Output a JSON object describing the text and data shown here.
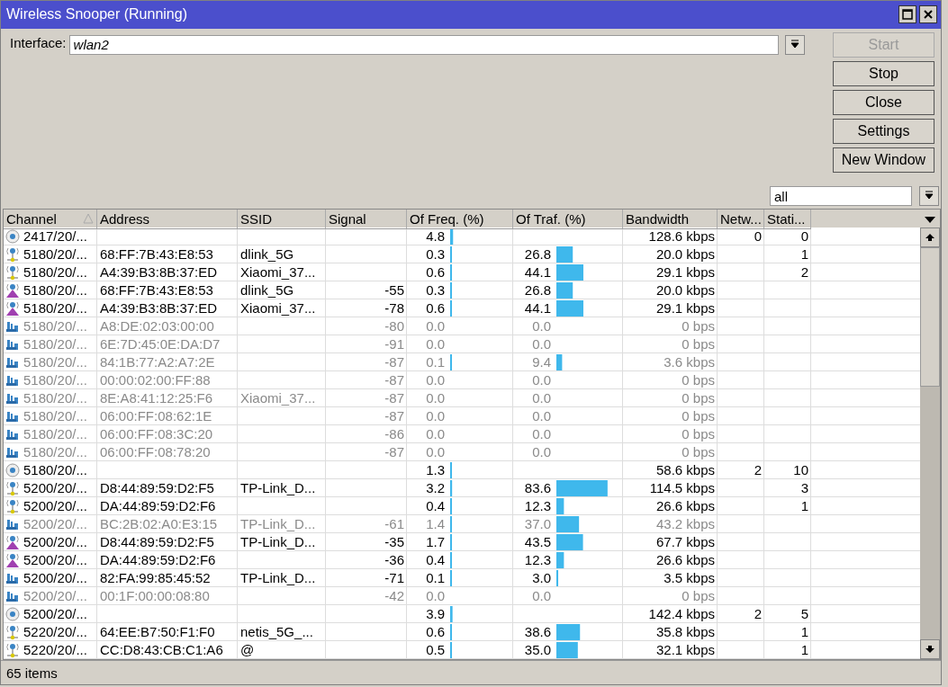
{
  "window": {
    "title": "Wireless Snooper (Running)"
  },
  "interface": {
    "label": "Interface:",
    "value": "wlan2"
  },
  "buttons": [
    {
      "label": "Start",
      "disabled": true
    },
    {
      "label": "Stop",
      "disabled": false
    },
    {
      "label": "Close",
      "disabled": false
    },
    {
      "label": "Settings",
      "disabled": false
    },
    {
      "label": "New Window",
      "disabled": false
    }
  ],
  "filter": {
    "value": "all"
  },
  "columns": [
    {
      "label": "Channel",
      "sorted": true
    },
    {
      "label": "Address",
      "sorted": false
    },
    {
      "label": "SSID",
      "sorted": false
    },
    {
      "label": "Signal",
      "sorted": false
    },
    {
      "label": "Of Freq. (%)",
      "sorted": false
    },
    {
      "label": "Of Traf. (%)",
      "sorted": false
    },
    {
      "label": "Bandwidth",
      "sorted": false
    },
    {
      "label": "Netw...",
      "sorted": false
    },
    {
      "label": "Stati...",
      "sorted": false
    }
  ],
  "rows": [
    {
      "kind": "network",
      "dimmed": false,
      "channel": "2417/20/...",
      "freq": {
        "text": "4.8",
        "level": 0.048
      },
      "bandwidth": "128.6 kbps",
      "networks": "0",
      "stations": "0"
    },
    {
      "kind": "ap",
      "dimmed": false,
      "channel": "5180/20/...",
      "address": "68:FF:7B:43:E8:53",
      "ssid": "dlink_5G",
      "freq": {
        "text": "0.3",
        "level": 0.003
      },
      "traf": {
        "text": "26.8",
        "level": 0.268
      },
      "bandwidth": "20.0 kbps",
      "stations": "1"
    },
    {
      "kind": "ap",
      "dimmed": false,
      "channel": "5180/20/...",
      "address": "A4:39:B3:8B:37:ED",
      "ssid": "Xiaomi_37...",
      "freq": {
        "text": "0.6",
        "level": 0.006
      },
      "traf": {
        "text": "44.1",
        "level": 0.441
      },
      "bandwidth": "29.1 kbps",
      "stations": "2"
    },
    {
      "kind": "station",
      "dimmed": false,
      "channel": "5180/20/...",
      "address": "68:FF:7B:43:E8:53",
      "ssid": "dlink_5G",
      "signal": "-55",
      "freq": {
        "text": "0.3",
        "level": 0.003
      },
      "traf": {
        "text": "26.8",
        "level": 0.268
      },
      "bandwidth": "20.0 kbps"
    },
    {
      "kind": "station",
      "dimmed": false,
      "channel": "5180/20/...",
      "address": "A4:39:B3:8B:37:ED",
      "ssid": "Xiaomi_37...",
      "signal": "-78",
      "freq": {
        "text": "0.6",
        "level": 0.006
      },
      "traf": {
        "text": "44.1",
        "level": 0.441
      },
      "bandwidth": "29.1 kbps"
    },
    {
      "kind": "device",
      "dimmed": true,
      "channel": "5180/20/...",
      "address": "A8:DE:02:03:00:00",
      "signal": "-80",
      "freq": {
        "text": "0.0"
      },
      "traf": {
        "text": "0.0"
      },
      "bandwidth": "0 bps"
    },
    {
      "kind": "device",
      "dimmed": true,
      "channel": "5180/20/...",
      "address": "6E:7D:45:0E:DA:D7",
      "signal": "-91",
      "freq": {
        "text": "0.0"
      },
      "traf": {
        "text": "0.0"
      },
      "bandwidth": "0 bps"
    },
    {
      "kind": "device",
      "dimmed": true,
      "channel": "5180/20/...",
      "address": "84:1B:77:A2:A7:2E",
      "signal": "-87",
      "freq": {
        "text": "0.1",
        "level": 0.001
      },
      "traf": {
        "text": "9.4",
        "level": 0.094
      },
      "bandwidth": "3.6 kbps"
    },
    {
      "kind": "device",
      "dimmed": true,
      "channel": "5180/20/...",
      "address": "00:00:02:00:FF:88",
      "signal": "-87",
      "freq": {
        "text": "0.0"
      },
      "traf": {
        "text": "0.0"
      },
      "bandwidth": "0 bps"
    },
    {
      "kind": "device",
      "dimmed": true,
      "channel": "5180/20/...",
      "address": "8E:A8:41:12:25:F6",
      "ssid": "Xiaomi_37...",
      "signal": "-87",
      "freq": {
        "text": "0.0"
      },
      "traf": {
        "text": "0.0"
      },
      "bandwidth": "0 bps"
    },
    {
      "kind": "device",
      "dimmed": true,
      "channel": "5180/20/...",
      "address": "06:00:FF:08:62:1E",
      "signal": "-87",
      "freq": {
        "text": "0.0"
      },
      "traf": {
        "text": "0.0"
      },
      "bandwidth": "0 bps"
    },
    {
      "kind": "device",
      "dimmed": true,
      "channel": "5180/20/...",
      "address": "06:00:FF:08:3C:20",
      "signal": "-86",
      "freq": {
        "text": "0.0"
      },
      "traf": {
        "text": "0.0"
      },
      "bandwidth": "0 bps"
    },
    {
      "kind": "device",
      "dimmed": true,
      "channel": "5180/20/...",
      "address": "06:00:FF:08:78:20",
      "signal": "-87",
      "freq": {
        "text": "0.0"
      },
      "traf": {
        "text": "0.0"
      },
      "bandwidth": "0 bps"
    },
    {
      "kind": "network",
      "dimmed": false,
      "channel": "5180/20/...",
      "freq": {
        "text": "1.3",
        "level": 0.013
      },
      "bandwidth": "58.6 kbps",
      "networks": "2",
      "stations": "10"
    },
    {
      "kind": "ap",
      "dimmed": false,
      "channel": "5200/20/...",
      "address": "D8:44:89:59:D2:F5",
      "ssid": "TP-Link_D...",
      "freq": {
        "text": "3.2",
        "level": 0.032
      },
      "traf": {
        "text": "83.6",
        "level": 0.836
      },
      "bandwidth": "114.5 kbps",
      "stations": "3"
    },
    {
      "kind": "ap",
      "dimmed": false,
      "channel": "5200/20/...",
      "address": "DA:44:89:59:D2:F6",
      "freq": {
        "text": "0.4",
        "level": 0.004
      },
      "traf": {
        "text": "12.3",
        "level": 0.123
      },
      "bandwidth": "26.6 kbps",
      "stations": "1"
    },
    {
      "kind": "device",
      "dimmed": true,
      "channel": "5200/20/...",
      "address": "BC:2B:02:A0:E3:15",
      "ssid": "TP-Link_D...",
      "signal": "-61",
      "freq": {
        "text": "1.4",
        "level": 0.014
      },
      "traf": {
        "text": "37.0",
        "level": 0.37
      },
      "bandwidth": "43.2 kbps"
    },
    {
      "kind": "station",
      "dimmed": false,
      "channel": "5200/20/...",
      "address": "D8:44:89:59:D2:F5",
      "ssid": "TP-Link_D...",
      "signal": "-35",
      "freq": {
        "text": "1.7",
        "level": 0.017
      },
      "traf": {
        "text": "43.5",
        "level": 0.435
      },
      "bandwidth": "67.7 kbps"
    },
    {
      "kind": "station",
      "dimmed": false,
      "channel": "5200/20/...",
      "address": "DA:44:89:59:D2:F6",
      "signal": "-36",
      "freq": {
        "text": "0.4",
        "level": 0.004
      },
      "traf": {
        "text": "12.3",
        "level": 0.123
      },
      "bandwidth": "26.6 kbps"
    },
    {
      "kind": "device",
      "dimmed": false,
      "channel": "5200/20/...",
      "address": "82:FA:99:85:45:52",
      "ssid": "TP-Link_D...",
      "signal": "-71",
      "freq": {
        "text": "0.1",
        "level": 0.001
      },
      "traf": {
        "text": "3.0",
        "level": 0.03
      },
      "bandwidth": "3.5 kbps"
    },
    {
      "kind": "device",
      "dimmed": true,
      "channel": "5200/20/...",
      "address": "00:1F:00:00:08:80",
      "signal": "-42",
      "freq": {
        "text": "0.0"
      },
      "traf": {
        "text": "0.0"
      },
      "bandwidth": "0 bps"
    },
    {
      "kind": "network",
      "dimmed": false,
      "channel": "5200/20/...",
      "freq": {
        "text": "3.9",
        "level": 0.039
      },
      "bandwidth": "142.4 kbps",
      "networks": "2",
      "stations": "5"
    },
    {
      "kind": "ap",
      "dimmed": false,
      "channel": "5220/20/...",
      "address": "64:EE:B7:50:F1:F0",
      "ssid": "netis_5G_...",
      "freq": {
        "text": "0.6",
        "level": 0.006
      },
      "traf": {
        "text": "38.6",
        "level": 0.386
      },
      "bandwidth": "35.8 kbps",
      "stations": "1"
    },
    {
      "kind": "ap",
      "dimmed": false,
      "channel": "5220/20/...",
      "address": "CC:D8:43:CB:C1:A6",
      "ssid": "@",
      "freq": {
        "text": "0.5",
        "level": 0.005
      },
      "traf": {
        "text": "35.0",
        "level": 0.35
      },
      "bandwidth": "32.1 kbps",
      "stations": "1"
    }
  ],
  "status_bar": {
    "text": "65 items"
  }
}
